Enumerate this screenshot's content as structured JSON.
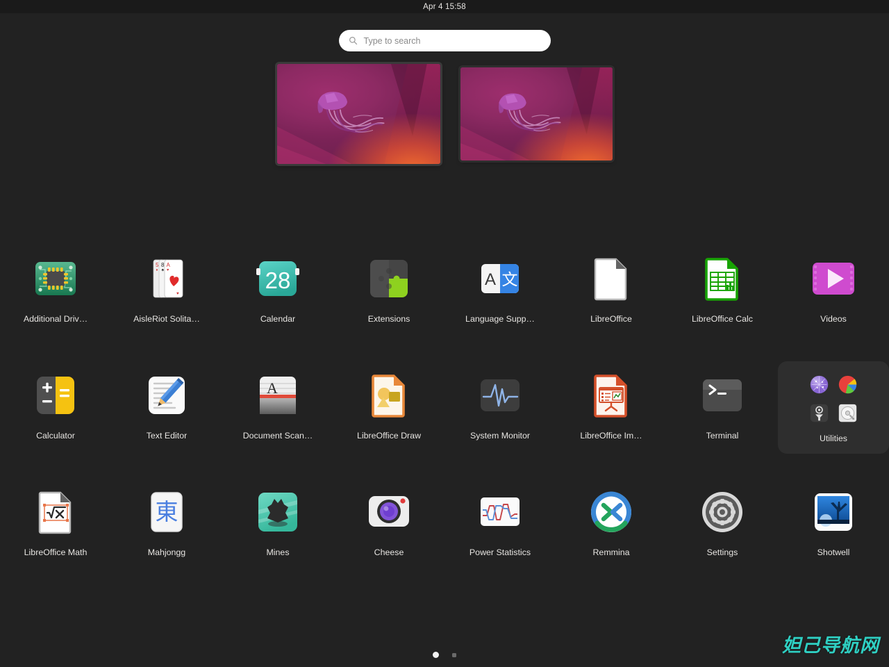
{
  "topbar": {
    "clock": "Apr 4  15:58"
  },
  "search": {
    "placeholder": "Type to search",
    "icon": "search-icon"
  },
  "workspaces": [
    {
      "name": "workspace-1",
      "wallpaper": "ubuntu-jellyfish",
      "active": true
    },
    {
      "name": "workspace-2",
      "wallpaper": "ubuntu-jellyfish",
      "active": false
    }
  ],
  "apps": [
    [
      {
        "label": "Additional Driv…",
        "icon": "chip-icon"
      },
      {
        "label": "AisleRiot Solita…",
        "icon": "playing-cards-icon"
      },
      {
        "label": "Calendar",
        "icon": "calendar-icon",
        "day": "28"
      },
      {
        "label": "Extensions",
        "icon": "puzzle-icon"
      },
      {
        "label": "Language Supp…",
        "icon": "translate-icon",
        "glyphs": [
          "A",
          "文"
        ]
      },
      {
        "label": "LibreOffice",
        "icon": "document-icon"
      },
      {
        "label": "LibreOffice Calc",
        "icon": "spreadsheet-icon"
      },
      {
        "label": "Videos",
        "icon": "play-icon"
      }
    ],
    [
      {
        "label": "Calculator",
        "icon": "calculator-icon"
      },
      {
        "label": "Text Editor",
        "icon": "pencil-document-icon"
      },
      {
        "label": "Document Scan…",
        "icon": "scanner-icon",
        "glyph": "A"
      },
      {
        "label": "LibreOffice Draw",
        "icon": "draw-shapes-icon"
      },
      {
        "label": "System Monitor",
        "icon": "waveform-icon"
      },
      {
        "label": "LibreOffice Im…",
        "icon": "presentation-icon"
      },
      {
        "label": "Terminal",
        "icon": "terminal-icon",
        "prompt": ">_"
      },
      {
        "label": "Utilities",
        "icon": "folder-icon",
        "is_folder": true,
        "contents": [
          "characters-icon",
          "disk-usage-analyzer-icon",
          "logs-icon",
          "disks-icon"
        ]
      }
    ],
    [
      {
        "label": "LibreOffice Math",
        "icon": "math-formula-icon"
      },
      {
        "label": "Mahjongg",
        "icon": "mahjong-tile-icon",
        "glyph": "東"
      },
      {
        "label": "Mines",
        "icon": "mine-icon"
      },
      {
        "label": "Cheese",
        "icon": "camera-icon"
      },
      {
        "label": "Power Statistics",
        "icon": "line-graph-icon"
      },
      {
        "label": "Remmina",
        "icon": "remote-desktop-icon"
      },
      {
        "label": "Settings",
        "icon": "gear-icon"
      },
      {
        "label": "Shotwell",
        "icon": "photo-tree-icon"
      }
    ]
  ],
  "pagination": {
    "pages": 2,
    "current": 1
  },
  "watermark": {
    "text": "妲己导航网",
    "color": "#2fcfc2"
  },
  "colors": {
    "background": "#222222",
    "topbar": "#1a1a1a",
    "text": "#e6e4e1",
    "folder_bg": "#2e2e2e"
  }
}
